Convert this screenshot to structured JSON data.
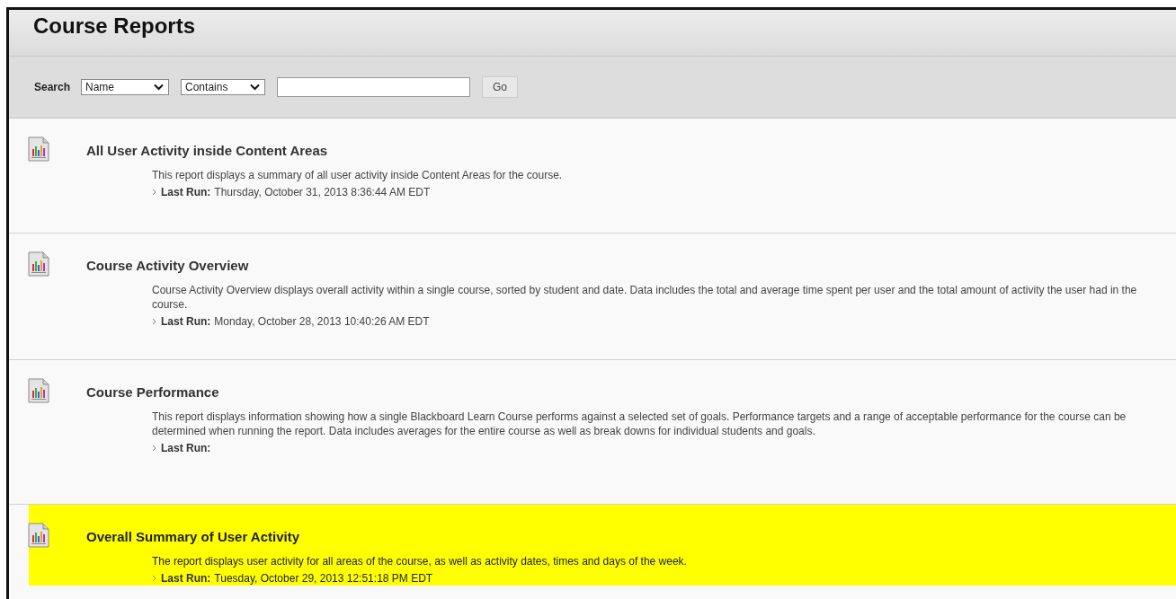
{
  "page_title": "Course Reports",
  "search": {
    "label": "Search",
    "field": "Name",
    "operator": "Contains",
    "button": "Go"
  },
  "reports": [
    {
      "title": "All User Activity inside Content Areas",
      "description": "This report displays a summary of all user activity inside Content Areas for the course.",
      "last_run_label": "Last Run:",
      "last_run": "Thursday, October 31, 2013 8:36:44 AM EDT",
      "highlighted": false
    },
    {
      "title": "Course Activity Overview",
      "description": "Course Activity Overview displays overall activity within a single course, sorted by student and date. Data includes the total and average time spent per user and the total amount of activity the user had in the course.",
      "last_run_label": "Last Run:",
      "last_run": "Monday, October 28, 2013 10:40:26 AM EDT",
      "highlighted": false
    },
    {
      "title": "Course Performance",
      "description": "This report displays information showing how a single Blackboard Learn Course performs against a selected set of goals. Performance targets and a range of acceptable performance for the course can be determined when running the report. Data includes averages for the entire course as well as break downs for individual students and goals.",
      "last_run_label": "Last Run:",
      "highlighted": false
    },
    {
      "title": "Overall Summary of User Activity",
      "description": "The report displays user activity for all areas of the course, as well as activity dates, times and days of the week.",
      "last_run_label": "Last Run:",
      "last_run": "Tuesday, October 29, 2013 12:51:18 PM EDT",
      "highlighted": true
    }
  ]
}
